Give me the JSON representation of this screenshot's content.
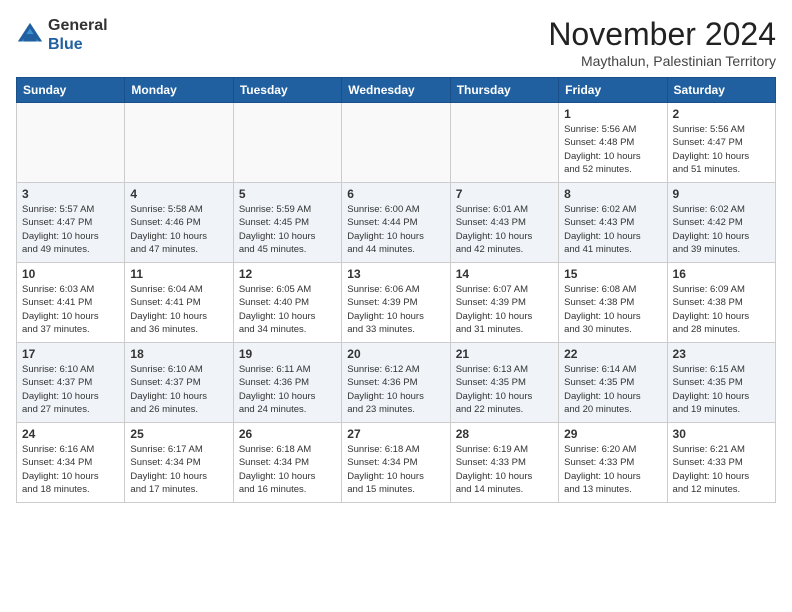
{
  "header": {
    "logo_line1": "General",
    "logo_line2": "Blue",
    "month_title": "November 2024",
    "location": "Maythalun, Palestinian Territory"
  },
  "weekdays": [
    "Sunday",
    "Monday",
    "Tuesday",
    "Wednesday",
    "Thursday",
    "Friday",
    "Saturday"
  ],
  "weeks": [
    [
      {
        "day": "",
        "info": ""
      },
      {
        "day": "",
        "info": ""
      },
      {
        "day": "",
        "info": ""
      },
      {
        "day": "",
        "info": ""
      },
      {
        "day": "",
        "info": ""
      },
      {
        "day": "1",
        "info": "Sunrise: 5:56 AM\nSunset: 4:48 PM\nDaylight: 10 hours\nand 52 minutes."
      },
      {
        "day": "2",
        "info": "Sunrise: 5:56 AM\nSunset: 4:47 PM\nDaylight: 10 hours\nand 51 minutes."
      }
    ],
    [
      {
        "day": "3",
        "info": "Sunrise: 5:57 AM\nSunset: 4:47 PM\nDaylight: 10 hours\nand 49 minutes."
      },
      {
        "day": "4",
        "info": "Sunrise: 5:58 AM\nSunset: 4:46 PM\nDaylight: 10 hours\nand 47 minutes."
      },
      {
        "day": "5",
        "info": "Sunrise: 5:59 AM\nSunset: 4:45 PM\nDaylight: 10 hours\nand 45 minutes."
      },
      {
        "day": "6",
        "info": "Sunrise: 6:00 AM\nSunset: 4:44 PM\nDaylight: 10 hours\nand 44 minutes."
      },
      {
        "day": "7",
        "info": "Sunrise: 6:01 AM\nSunset: 4:43 PM\nDaylight: 10 hours\nand 42 minutes."
      },
      {
        "day": "8",
        "info": "Sunrise: 6:02 AM\nSunset: 4:43 PM\nDaylight: 10 hours\nand 41 minutes."
      },
      {
        "day": "9",
        "info": "Sunrise: 6:02 AM\nSunset: 4:42 PM\nDaylight: 10 hours\nand 39 minutes."
      }
    ],
    [
      {
        "day": "10",
        "info": "Sunrise: 6:03 AM\nSunset: 4:41 PM\nDaylight: 10 hours\nand 37 minutes."
      },
      {
        "day": "11",
        "info": "Sunrise: 6:04 AM\nSunset: 4:41 PM\nDaylight: 10 hours\nand 36 minutes."
      },
      {
        "day": "12",
        "info": "Sunrise: 6:05 AM\nSunset: 4:40 PM\nDaylight: 10 hours\nand 34 minutes."
      },
      {
        "day": "13",
        "info": "Sunrise: 6:06 AM\nSunset: 4:39 PM\nDaylight: 10 hours\nand 33 minutes."
      },
      {
        "day": "14",
        "info": "Sunrise: 6:07 AM\nSunset: 4:39 PM\nDaylight: 10 hours\nand 31 minutes."
      },
      {
        "day": "15",
        "info": "Sunrise: 6:08 AM\nSunset: 4:38 PM\nDaylight: 10 hours\nand 30 minutes."
      },
      {
        "day": "16",
        "info": "Sunrise: 6:09 AM\nSunset: 4:38 PM\nDaylight: 10 hours\nand 28 minutes."
      }
    ],
    [
      {
        "day": "17",
        "info": "Sunrise: 6:10 AM\nSunset: 4:37 PM\nDaylight: 10 hours\nand 27 minutes."
      },
      {
        "day": "18",
        "info": "Sunrise: 6:10 AM\nSunset: 4:37 PM\nDaylight: 10 hours\nand 26 minutes."
      },
      {
        "day": "19",
        "info": "Sunrise: 6:11 AM\nSunset: 4:36 PM\nDaylight: 10 hours\nand 24 minutes."
      },
      {
        "day": "20",
        "info": "Sunrise: 6:12 AM\nSunset: 4:36 PM\nDaylight: 10 hours\nand 23 minutes."
      },
      {
        "day": "21",
        "info": "Sunrise: 6:13 AM\nSunset: 4:35 PM\nDaylight: 10 hours\nand 22 minutes."
      },
      {
        "day": "22",
        "info": "Sunrise: 6:14 AM\nSunset: 4:35 PM\nDaylight: 10 hours\nand 20 minutes."
      },
      {
        "day": "23",
        "info": "Sunrise: 6:15 AM\nSunset: 4:35 PM\nDaylight: 10 hours\nand 19 minutes."
      }
    ],
    [
      {
        "day": "24",
        "info": "Sunrise: 6:16 AM\nSunset: 4:34 PM\nDaylight: 10 hours\nand 18 minutes."
      },
      {
        "day": "25",
        "info": "Sunrise: 6:17 AM\nSunset: 4:34 PM\nDaylight: 10 hours\nand 17 minutes."
      },
      {
        "day": "26",
        "info": "Sunrise: 6:18 AM\nSunset: 4:34 PM\nDaylight: 10 hours\nand 16 minutes."
      },
      {
        "day": "27",
        "info": "Sunrise: 6:18 AM\nSunset: 4:34 PM\nDaylight: 10 hours\nand 15 minutes."
      },
      {
        "day": "28",
        "info": "Sunrise: 6:19 AM\nSunset: 4:33 PM\nDaylight: 10 hours\nand 14 minutes."
      },
      {
        "day": "29",
        "info": "Sunrise: 6:20 AM\nSunset: 4:33 PM\nDaylight: 10 hours\nand 13 minutes."
      },
      {
        "day": "30",
        "info": "Sunrise: 6:21 AM\nSunset: 4:33 PM\nDaylight: 10 hours\nand 12 minutes."
      }
    ]
  ]
}
